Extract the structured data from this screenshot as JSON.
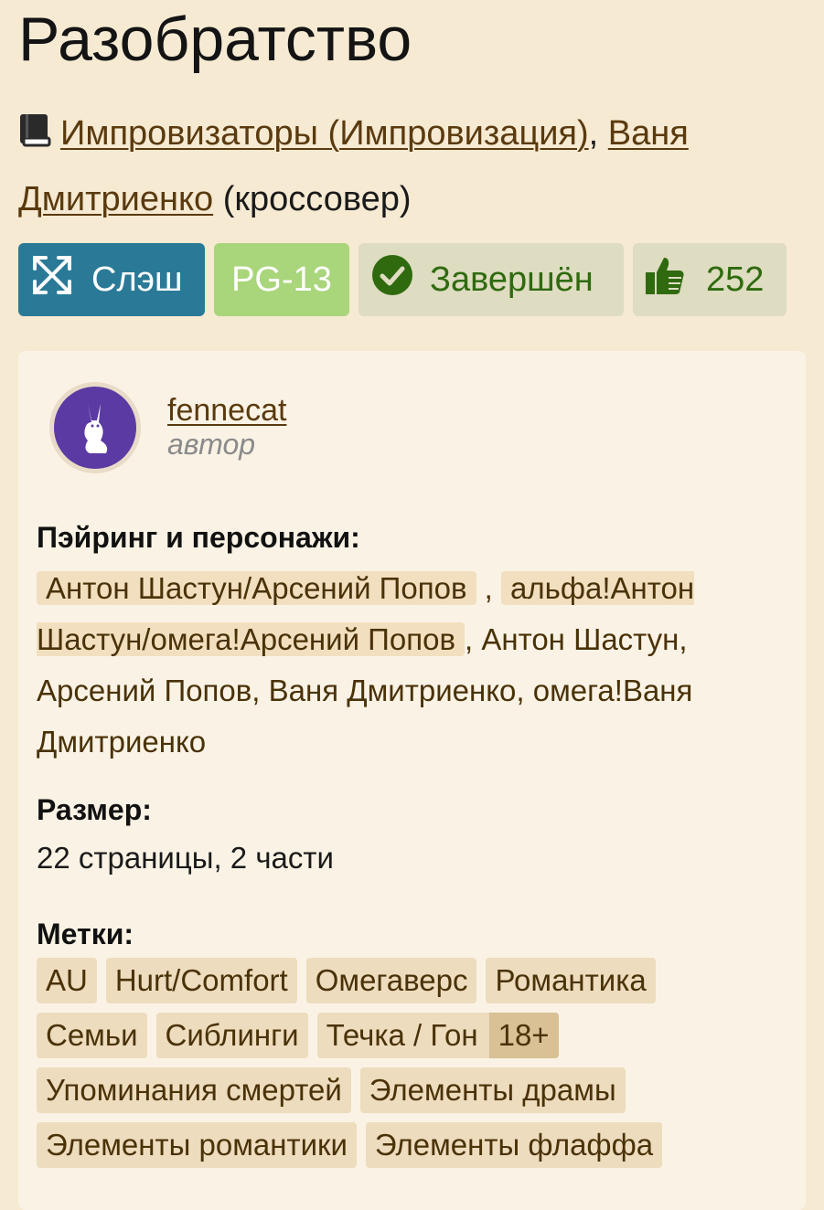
{
  "title": "Разобратство",
  "fandoms": {
    "items": [
      "Импровизаторы (Импровизация)",
      "Ваня Дмитриенко"
    ],
    "separator": ",",
    "note": "(кроссовер)"
  },
  "badges": {
    "direction": "Слэш",
    "rating": "PG-13",
    "status": "Завершён",
    "likes": "252"
  },
  "author": {
    "name": "fennecat",
    "role": "автор"
  },
  "pairing": {
    "label": "Пэйринг и персонажи:",
    "highlighted": [
      "Антон Шастун/Арсений Попов",
      "альфа!Антон Шастун/омега!Арсений Попов"
    ],
    "rest": ", Антон Шастун, Арсений Попов, Ваня Дмитриенко, омега!Ваня Дмитриенко"
  },
  "size": {
    "label": "Размер:",
    "value": "22 страницы, 2 части"
  },
  "tags": {
    "label": "Метки:",
    "rows": [
      [
        "AU",
        "Hurt/Comfort",
        "Омегаверс",
        "Романтика"
      ],
      [
        "Семьи",
        "Сиблинги",
        "Течка / Гон"
      ],
      [
        "Упоминания смертей",
        "Элементы драмы"
      ],
      [
        "Элементы романтики",
        "Элементы флаффа"
      ]
    ],
    "adult_marker": "18+"
  },
  "colors": {
    "background": "#f6ead3",
    "slash": "#2a7a97",
    "rating": "#a9d57b",
    "status_text": "#2f6a0f",
    "link": "#5a3a0e"
  },
  "icons": {
    "fandom": "book-icon",
    "direction": "crossed-arrows-icon",
    "status": "check-circle-icon",
    "likes": "thumbs-up-icon"
  }
}
